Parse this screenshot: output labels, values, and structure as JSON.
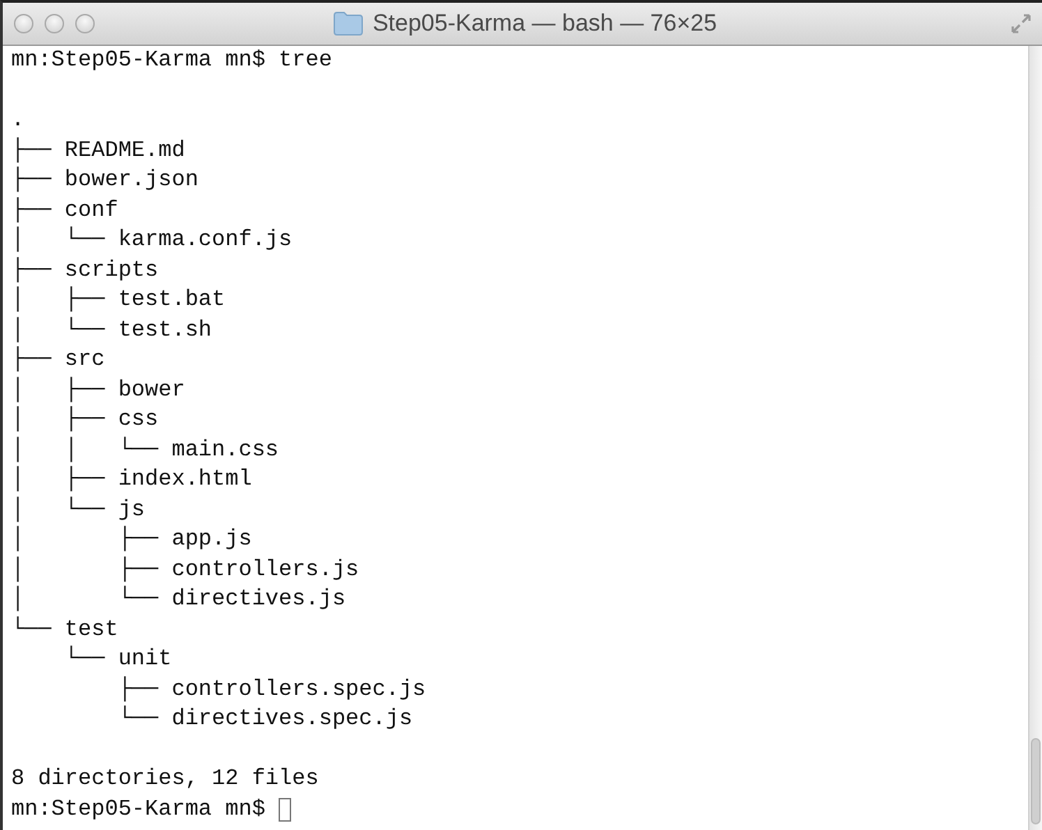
{
  "window": {
    "title": "Step05-Karma — bash — 76×25"
  },
  "terminal": {
    "lines": [
      {
        "text": "mn:Step05-Karma mn$ tree",
        "blank_before": false
      },
      {
        "text": ".",
        "blank_before": true
      },
      {
        "text": "├── README.md",
        "blank_before": false
      },
      {
        "text": "├── bower.json",
        "blank_before": false
      },
      {
        "text": "├── conf",
        "blank_before": false
      },
      {
        "text": "│   └── karma.conf.js",
        "blank_before": false
      },
      {
        "text": "├── scripts",
        "blank_before": false
      },
      {
        "text": "│   ├── test.bat",
        "blank_before": false
      },
      {
        "text": "│   └── test.sh",
        "blank_before": false
      },
      {
        "text": "├── src",
        "blank_before": false
      },
      {
        "text": "│   ├── bower",
        "blank_before": false
      },
      {
        "text": "│   ├── css",
        "blank_before": false
      },
      {
        "text": "│   │   └── main.css",
        "blank_before": false
      },
      {
        "text": "│   ├── index.html",
        "blank_before": false
      },
      {
        "text": "│   └── js",
        "blank_before": false
      },
      {
        "text": "│       ├── app.js",
        "blank_before": false
      },
      {
        "text": "│       ├── controllers.js",
        "blank_before": false
      },
      {
        "text": "│       └── directives.js",
        "blank_before": false
      },
      {
        "text": "└── test",
        "blank_before": false
      },
      {
        "text": "    └── unit",
        "blank_before": false
      },
      {
        "text": "        ├── controllers.spec.js",
        "blank_before": false
      },
      {
        "text": "        └── directives.spec.js",
        "blank_before": false
      },
      {
        "text": "8 directories, 12 files",
        "blank_before": true
      },
      {
        "text": "mn:Step05-Karma mn$ ",
        "blank_before": false
      }
    ],
    "cursor": true
  }
}
